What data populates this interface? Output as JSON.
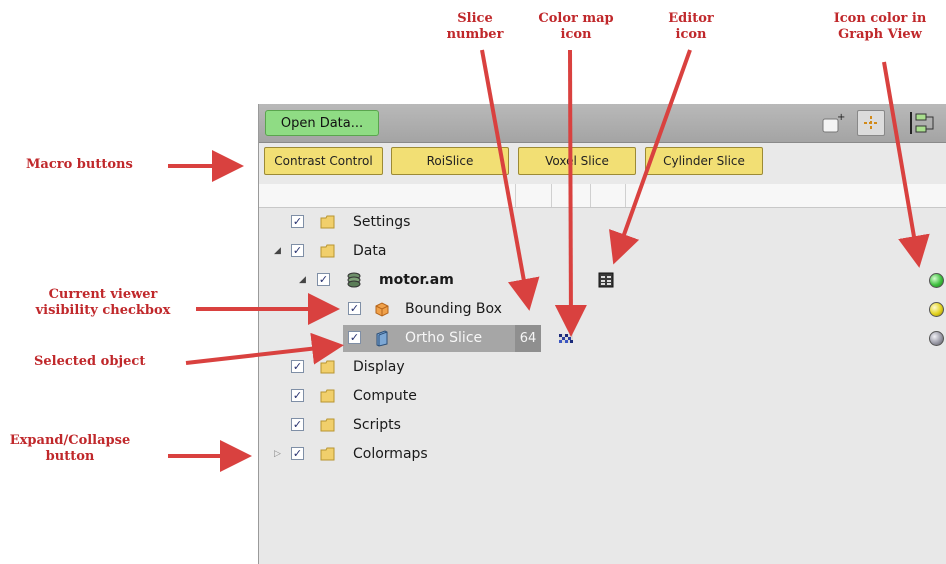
{
  "callouts": {
    "slice_number": [
      "Slice",
      "number"
    ],
    "color_map_icon": [
      "Color map",
      "icon"
    ],
    "editor_icon": [
      "Editor",
      "icon"
    ],
    "icon_color": [
      "Icon color in",
      "Graph View"
    ],
    "macro_buttons": "Macro buttons",
    "visibility_checkbox": [
      "Current viewer",
      "visibility checkbox"
    ],
    "selected_object": "Selected object",
    "expand_collapse": [
      "Expand/Collapse",
      "button"
    ]
  },
  "toolbar": {
    "open_data_label": "Open Data..."
  },
  "macros": [
    "Contrast Control",
    "RoiSlice",
    "Voxel Slice",
    "Cylinder Slice"
  ],
  "tree": {
    "settings": "Settings",
    "data": "Data",
    "motor": "motor.am",
    "bounding_box": "Bounding Box",
    "ortho_slice": "Ortho Slice",
    "ortho_slice_number": "64",
    "display": "Display",
    "compute": "Compute",
    "scripts": "Scripts",
    "colormaps": "Colormaps"
  },
  "colors": {
    "annotation": "#c0282b",
    "open_data_button": "#8fdc84",
    "macro_button": "#f2df74",
    "selection": "#a6a6a6",
    "graph_green": "#3fbf3f",
    "graph_yellow": "#e2d21e",
    "graph_grey": "#9a9aa6"
  }
}
